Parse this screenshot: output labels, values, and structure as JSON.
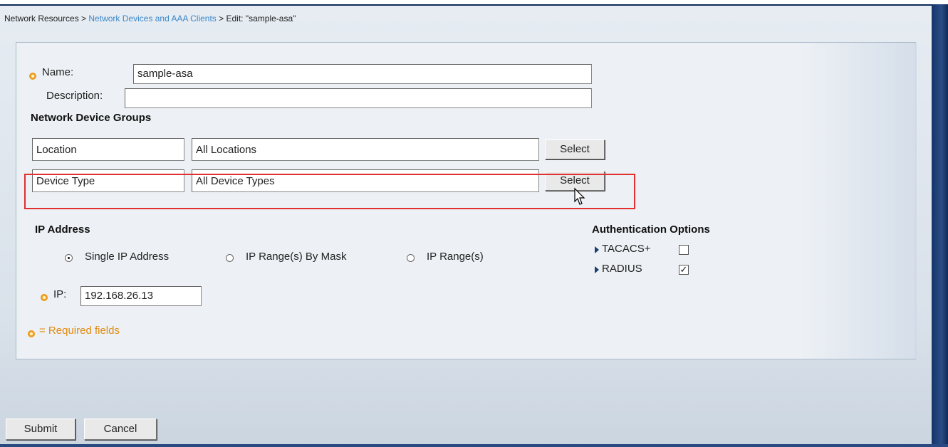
{
  "breadcrumb": {
    "root": "Network Resources",
    "sep1": " > ",
    "link": "Network Devices and AAA Clients",
    "sep2": " > ",
    "current": "Edit: \"sample-asa\""
  },
  "form": {
    "name_label": "Name:",
    "name_value": "sample-asa",
    "description_label": "Description:",
    "description_value": "",
    "ndg_heading": "Network Device Groups",
    "groups": [
      {
        "name": "Location",
        "value": "All Locations",
        "button": "Select"
      },
      {
        "name": "Device Type",
        "value": "All Device Types",
        "button": "Select"
      }
    ],
    "ip_heading": "IP Address",
    "ip_options": [
      {
        "label": "Single IP Address",
        "selected": true
      },
      {
        "label": "IP Range(s) By Mask",
        "selected": false
      },
      {
        "label": "IP Range(s)",
        "selected": false
      }
    ],
    "ip_label": "IP:",
    "ip_value": "192.168.26.13",
    "auth_heading": "Authentication Options",
    "auth_options": [
      {
        "label": "TACACS+",
        "checked": false
      },
      {
        "label": "RADIUS",
        "checked": true
      }
    ],
    "required_note": "= Required fields"
  },
  "actions": {
    "submit": "Submit",
    "cancel": "Cancel"
  },
  "colors": {
    "link": "#3a87c9",
    "required": "#e08a10",
    "highlight": "#e03030",
    "frame": "#15346a"
  }
}
